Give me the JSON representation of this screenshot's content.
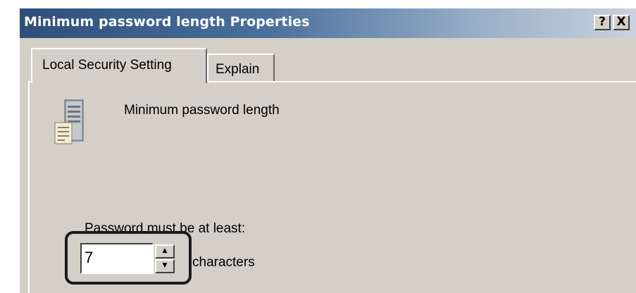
{
  "window": {
    "title": "Minimum password length Properties",
    "help_glyph": "?",
    "close_glyph": "X"
  },
  "tabs": [
    {
      "label": "Local Security Setting",
      "active": true
    },
    {
      "label": "Explain",
      "active": false
    }
  ],
  "policy": {
    "icon": "server-policy-icon",
    "name": "Minimum password length"
  },
  "setting": {
    "prompt": "Password must be at least:",
    "value": "7",
    "unit": "characters",
    "spin_up_glyph": "▲",
    "spin_down_glyph": "▼"
  },
  "colors": {
    "titlebar_start": "#2e4f7a",
    "titlebar_end": "#c9d2dc",
    "dialog_face": "#d4d0c8",
    "highlight_frame": "#1a1a1a"
  }
}
